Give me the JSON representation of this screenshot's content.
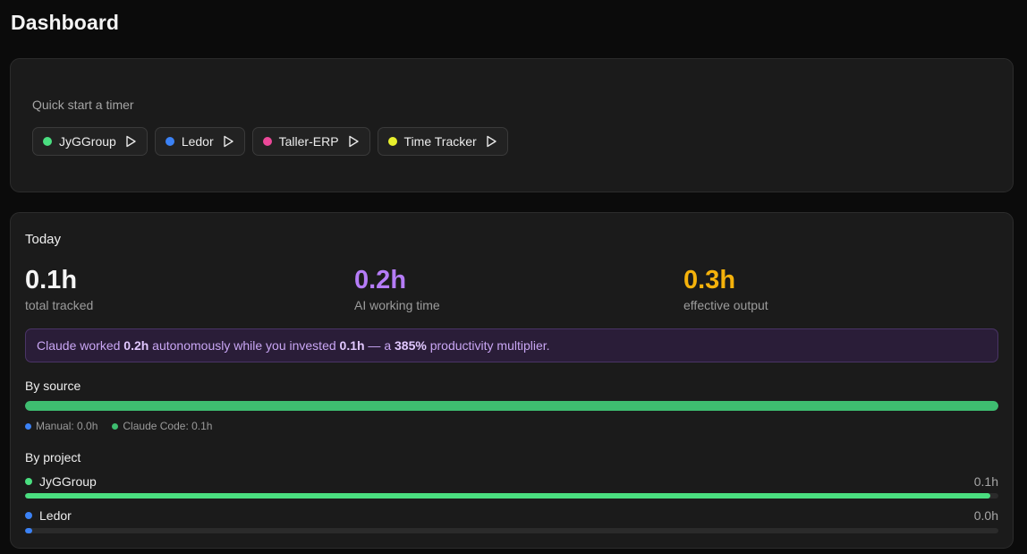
{
  "page": {
    "title": "Dashboard"
  },
  "quick_start": {
    "label": "Quick start a timer",
    "projects": [
      {
        "name": "JyGGroup",
        "color": "#4ade80"
      },
      {
        "name": "Ledor",
        "color": "#3b82f6"
      },
      {
        "name": "Taller-ERP",
        "color": "#ec4899"
      },
      {
        "name": "Time Tracker",
        "color": "#e8f02d"
      }
    ]
  },
  "today": {
    "title": "Today",
    "stats": [
      {
        "value": "0.1h",
        "label": "total tracked",
        "color": "#f5f5f5"
      },
      {
        "value": "0.2h",
        "label": "AI working time",
        "color": "#b57cf7"
      },
      {
        "value": "0.3h",
        "label": "effective output",
        "color": "#f5b20b"
      }
    ],
    "banner": {
      "t1": "Claude worked ",
      "b1": "0.2h",
      "t2": " autonomously while you invested ",
      "b2": "0.1h",
      "t3": " — a ",
      "b3": "385%",
      "t4": " productivity multiplier."
    },
    "by_source": {
      "title": "By source",
      "segments": [
        {
          "label": "Manual: 0.0h",
          "fraction": 0.0,
          "color": "#3b82f6"
        },
        {
          "label": "Claude Code: 0.1h",
          "fraction": 1.0,
          "color": "#3ebd70"
        }
      ]
    },
    "by_project": {
      "title": "By project",
      "projects": [
        {
          "name": "JyGGroup",
          "hours": "0.1h",
          "fraction": 0.992,
          "color": "#4ade80"
        },
        {
          "name": "Ledor",
          "hours": "0.0h",
          "fraction": 0.007,
          "color": "#3b82f6"
        }
      ]
    }
  }
}
